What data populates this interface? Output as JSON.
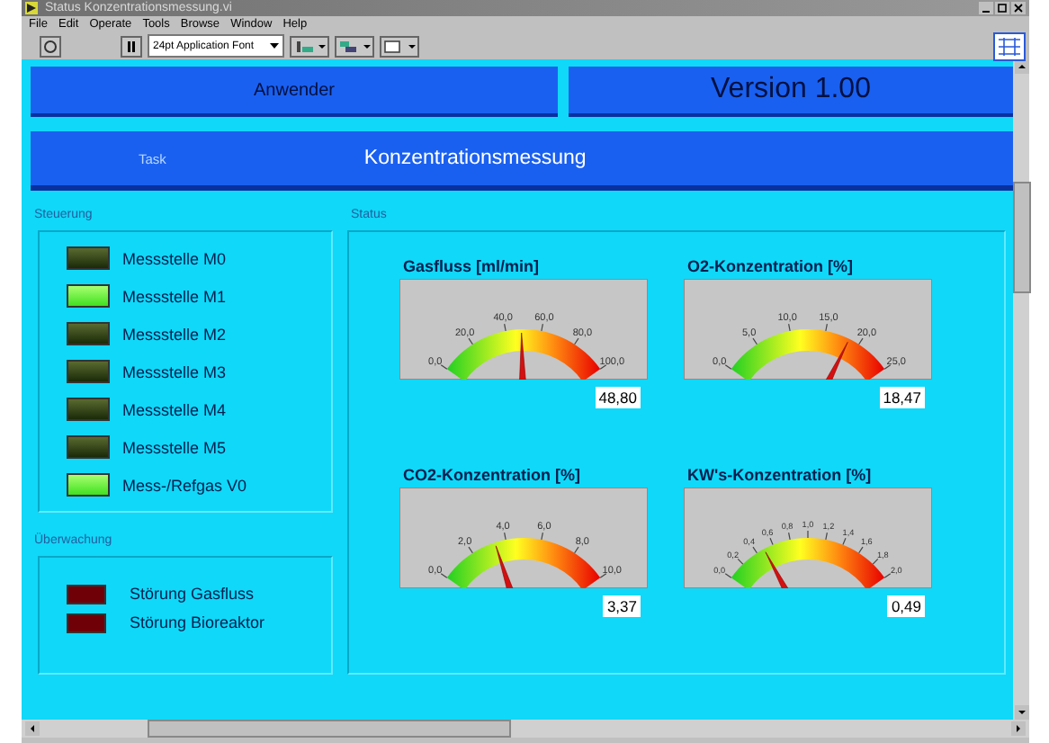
{
  "window": {
    "title": "Status Konzentrationsmessung.vi"
  },
  "menu": [
    {
      "label": "File"
    },
    {
      "label": "Edit"
    },
    {
      "label": "Operate"
    },
    {
      "label": "Tools"
    },
    {
      "label": "Browse"
    },
    {
      "label": "Window"
    },
    {
      "label": "Help"
    }
  ],
  "toolbar": {
    "font": "24pt Application Font"
  },
  "header": {
    "user": "Anwender",
    "version": "Version 1.00"
  },
  "task": {
    "label": "Task",
    "value": "Konzentrationsmessung"
  },
  "steuerung": {
    "title": "Steuerung",
    "leds": [
      {
        "label": "Messstelle M0",
        "on": false
      },
      {
        "label": "Messstelle M1",
        "on": true
      },
      {
        "label": "Messstelle M2",
        "on": false
      },
      {
        "label": "Messstelle M3",
        "on": false
      },
      {
        "label": "Messstelle M4",
        "on": false
      },
      {
        "label": "Messstelle M5",
        "on": false
      },
      {
        "label": "Mess-/Refgas V0",
        "on": true
      }
    ]
  },
  "ueberwachung": {
    "title": "Überwachung",
    "alarms": [
      {
        "label": "Störung Gasfluss",
        "on": false
      },
      {
        "label": "Störung Bioreaktor",
        "on": false
      }
    ]
  },
  "status": {
    "title": "Status",
    "gauges": [
      {
        "title": "Gasfluss [ml/min]",
        "ticks": [
          "0,0",
          "20,0",
          "40,0",
          "60,0",
          "80,0",
          "100,0"
        ],
        "value": "48,80"
      },
      {
        "title": "O2-Konzentration [%]",
        "ticks": [
          "0,0",
          "5,0",
          "10,0",
          "15,0",
          "20,0",
          "25,0"
        ],
        "value": "18,47"
      },
      {
        "title": "CO2-Konzentration [%]",
        "ticks": [
          "0,0",
          "2,0",
          "4,0",
          "6,0",
          "8,0",
          "10,0"
        ],
        "value": "3,37"
      },
      {
        "title": "KW's-Konzentration [%]",
        "ticks": [
          "0,0",
          "0,2",
          "0,4",
          "0,6",
          "0,8",
          "1,0",
          "1,2",
          "1,4",
          "1,6",
          "1,8",
          "2,0"
        ],
        "value": "0,49"
      }
    ]
  }
}
